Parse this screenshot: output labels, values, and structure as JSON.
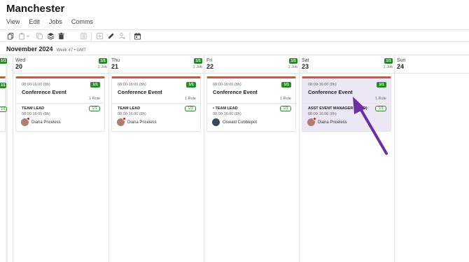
{
  "app": {
    "title": "Manchester"
  },
  "menu": [
    "View",
    "Edit",
    "Jobs",
    "Comms"
  ],
  "toolbar": {
    "icons": [
      "copy-icon",
      "paste-icon",
      "chevron-down-icon",
      "copy-multiple-icon",
      "stack-icon",
      "trash-icon",
      "list-icon",
      "add-icon",
      "pencil-icon",
      "assign-user-icon",
      "calendar-icon"
    ]
  },
  "calendar": {
    "month": "November 2024",
    "week_info": "Week 47 • GMT",
    "edge": {
      "badge": "1/1",
      "role_badge": "1/1"
    },
    "days": [
      {
        "name": "Wed",
        "date": "20",
        "badge": "1/1",
        "jobs": "1 Job",
        "card": {
          "time": "08:00-16:00 (8h)",
          "badge": "1/1",
          "title": "Conference Event",
          "roles": "1 Role",
          "role": {
            "name": "TEAM LEAD",
            "badge": "1/1",
            "time": "08:00-16:00 (8h)",
            "person": "Diana Priceless"
          }
        }
      },
      {
        "name": "Thu",
        "date": "21",
        "badge": "1/1",
        "jobs": "1 Job",
        "card": {
          "time": "08:00-16:00 (8h)",
          "badge": "1/1",
          "title": "Conference Event",
          "roles": "1 Role",
          "role": {
            "name": "TEAM LEAD",
            "badge": "1/1",
            "time": "08:00-16:00 (8h)",
            "person": "Diana Priceless"
          }
        }
      },
      {
        "name": "Fri",
        "date": "22",
        "badge": "1/1",
        "jobs": "1 Job",
        "card": {
          "time": "08:00-16:00 (8h)",
          "badge": "1/1",
          "title": "Conference Event",
          "roles": "1 Role",
          "role": {
            "name": "• TEAM LEAD",
            "badge": "1/1",
            "time": "08:00-16:00 (8h)",
            "person": "Oswald Cobblepot"
          }
        }
      },
      {
        "name": "Sat",
        "date": "23",
        "badge": "1/1",
        "jobs": "1 Job",
        "card": {
          "time": "08:00-16:00 (8h)",
          "badge": "1/1",
          "title": "Conference Event",
          "roles": "1 Role",
          "role": {
            "name": "ASST EVENT MANAGER (LEAD)",
            "badge": "1/1",
            "time": "08:00-16:00 (8h)",
            "person": "Diana Priceless"
          }
        }
      },
      {
        "name": "Sun",
        "date": "24"
      }
    ]
  },
  "colors": {
    "accent_bar": "#d9532b",
    "badge_green": "#2a8a2a",
    "highlight": "#ede6f5",
    "arrow": "#6b2fa3"
  }
}
